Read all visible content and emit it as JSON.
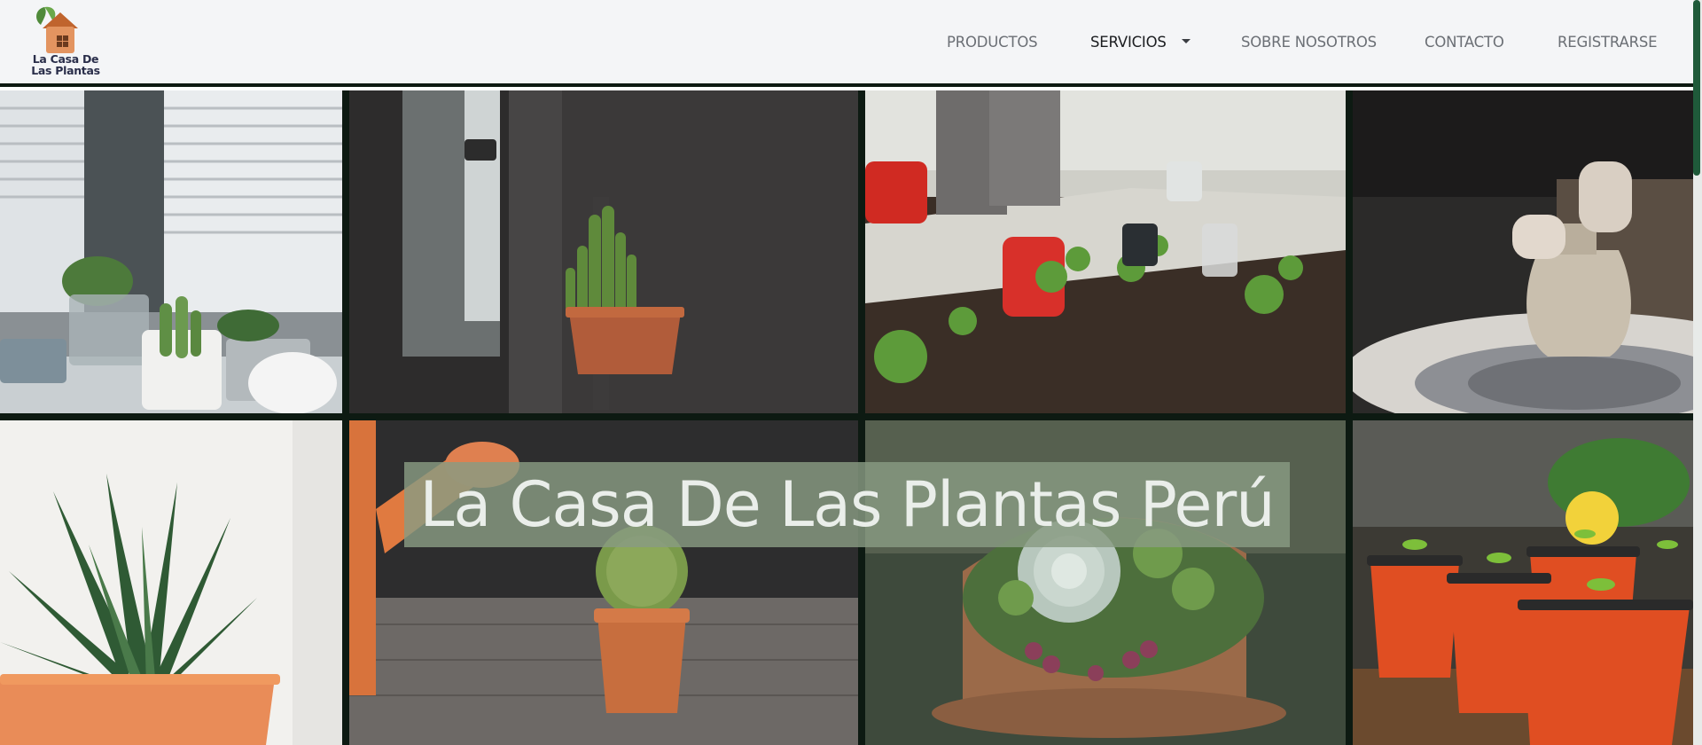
{
  "brand": {
    "logo_line1": "La Casa De",
    "logo_line2": "Las Plantas",
    "logo_icon": "house-leaf-icon"
  },
  "nav": {
    "items": [
      {
        "label": "PRODUCTOS"
      },
      {
        "label": "SERVICIOS",
        "has_dropdown": true
      },
      {
        "label": "SOBRE NOSOTROS"
      },
      {
        "label": "CONTACTO"
      },
      {
        "label": "REGISTRARSE"
      }
    ],
    "active_index": 1
  },
  "hero": {
    "title": "La Casa De Las Plantas Perú"
  },
  "gallery": {
    "tiles": [
      {
        "name": "windowsill-succulents-photo"
      },
      {
        "name": "potted-cactus-by-window-photo"
      },
      {
        "name": "gardening-gloves-planting-photo"
      },
      {
        "name": "pottery-wheel-vase-photo"
      },
      {
        "name": "aloe-plant-pot-photo"
      },
      {
        "name": "watering-can-cactus-photo"
      },
      {
        "name": "succulent-bowl-photo"
      },
      {
        "name": "seedling-red-pots-photo"
      }
    ]
  },
  "colors": {
    "header_bg": "#f4f5f7",
    "nav_text": "#6b6f75",
    "nav_active": "#1b1d20",
    "gallery_gap": "#0d1a12",
    "accent_green": "#1f5a3a",
    "hero_overlay": "#899b82"
  }
}
